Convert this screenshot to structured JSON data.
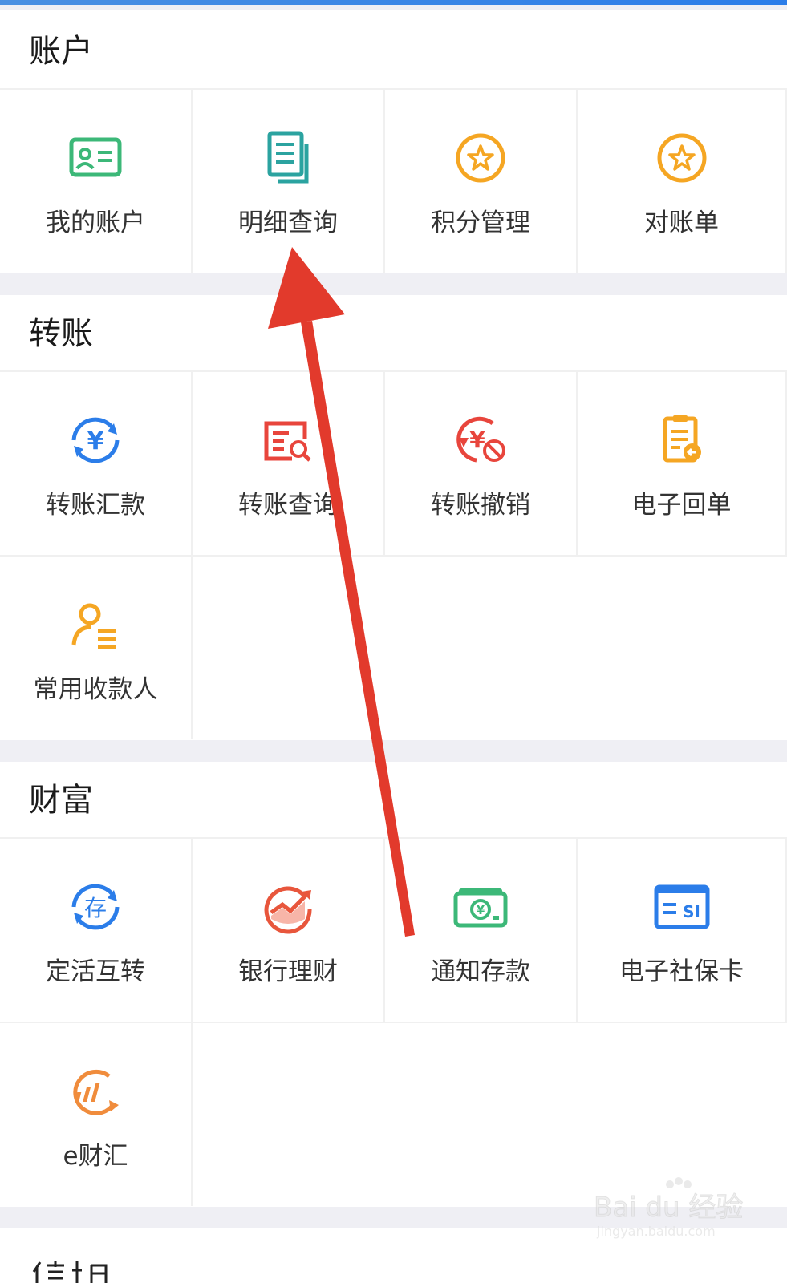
{
  "sections": [
    {
      "title": "账户",
      "items": [
        {
          "label": "我的账户",
          "icon": "id-card-icon"
        },
        {
          "label": "明细查询",
          "icon": "document-list-icon"
        },
        {
          "label": "积分管理",
          "icon": "star-circle-icon"
        },
        {
          "label": "对账单",
          "icon": "star-circle-icon"
        }
      ]
    },
    {
      "title": "转账",
      "items": [
        {
          "label": "转账汇款",
          "icon": "yuan-transfer-icon"
        },
        {
          "label": "转账查询",
          "icon": "transfer-search-icon"
        },
        {
          "label": "转账撤销",
          "icon": "transfer-cancel-icon"
        },
        {
          "label": "电子回单",
          "icon": "receipt-icon"
        },
        {
          "label": "常用收款人",
          "icon": "payee-icon"
        }
      ]
    },
    {
      "title": "财富",
      "items": [
        {
          "label": "定活互转",
          "icon": "deposit-exchange-icon"
        },
        {
          "label": "银行理财",
          "icon": "wealth-chart-icon"
        },
        {
          "label": "通知存款",
          "icon": "banknote-icon"
        },
        {
          "label": "电子社保卡",
          "icon": "social-security-card-icon"
        },
        {
          "label": "e财汇",
          "icon": "e-wealth-icon"
        }
      ]
    }
  ],
  "colors": {
    "accent_blue": "#2b7de9",
    "green": "#3cb878",
    "orange": "#f5a623",
    "red": "#e8453c",
    "arrow_red": "#e23a2c"
  },
  "watermark": {
    "text": "Bai du 经验",
    "sub": "jingyan.baidu.com"
  }
}
